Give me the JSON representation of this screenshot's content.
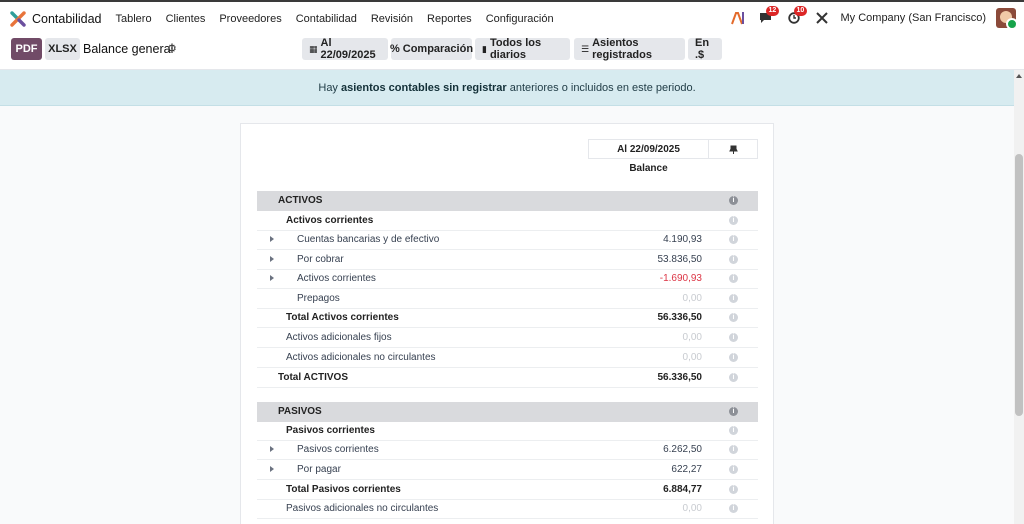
{
  "topbar": {
    "app_name": "Contabilidad",
    "menu": [
      "Tablero",
      "Clientes",
      "Proveedores",
      "Contabilidad",
      "Revisión",
      "Reportes",
      "Configuración"
    ],
    "company": "My Company (San Francisco)",
    "messages_count": "12",
    "activities_count": "10"
  },
  "controls": {
    "pdf_label": "PDF",
    "xlsx_label": "XLSX",
    "report_title": "Balance general",
    "date_filter": "Al 22/09/2025",
    "comparison_filter": "Comparación",
    "journals_filter": "Todos los diarios",
    "entries_filter": "Asientos registrados",
    "currency_filter": "En .$"
  },
  "alert": {
    "before": "Hay ",
    "link": "asientos contables sin registrar",
    "after": " anteriores o incluidos en este periodo."
  },
  "report": {
    "column_header": "Al 22/09/2025",
    "column_subheader": "Balance",
    "rows": [
      {
        "label": "ACTIVOS",
        "value": "",
        "type": "section"
      },
      {
        "label": "Activos corrientes",
        "value": "",
        "type": "group"
      },
      {
        "label": "Cuentas bancarias y de efectivo",
        "value": "4.190,93",
        "type": "line",
        "expandable": true
      },
      {
        "label": "Por cobrar",
        "value": "53.836,50",
        "type": "line",
        "expandable": true
      },
      {
        "label": "Activos corrientes",
        "value": "-1.690,93",
        "type": "line",
        "expandable": true,
        "negative": true
      },
      {
        "label": "Prepagos",
        "value": "0,00",
        "type": "line",
        "zero": true
      },
      {
        "label": "Total Activos corrientes",
        "value": "56.336,50",
        "type": "total"
      },
      {
        "label": "Activos adicionales fijos",
        "value": "0,00",
        "type": "group-plain",
        "zero": true
      },
      {
        "label": "Activos adicionales no circulantes",
        "value": "0,00",
        "type": "group-plain",
        "zero": true
      },
      {
        "label": "Total ACTIVOS",
        "value": "56.336,50",
        "type": "grand-total"
      },
      {
        "label": "PASIVOS",
        "value": "",
        "type": "section"
      },
      {
        "label": "Pasivos corrientes",
        "value": "",
        "type": "group"
      },
      {
        "label": "Pasivos corrientes",
        "value": "6.262,50",
        "type": "line",
        "expandable": true
      },
      {
        "label": "Por pagar",
        "value": "622,27",
        "type": "line",
        "expandable": true
      },
      {
        "label": "Total Pasivos corrientes",
        "value": "6.884,77",
        "type": "total"
      },
      {
        "label": "Pasivos adicionales no circulantes",
        "value": "0,00",
        "type": "group-plain",
        "zero": true
      }
    ]
  }
}
